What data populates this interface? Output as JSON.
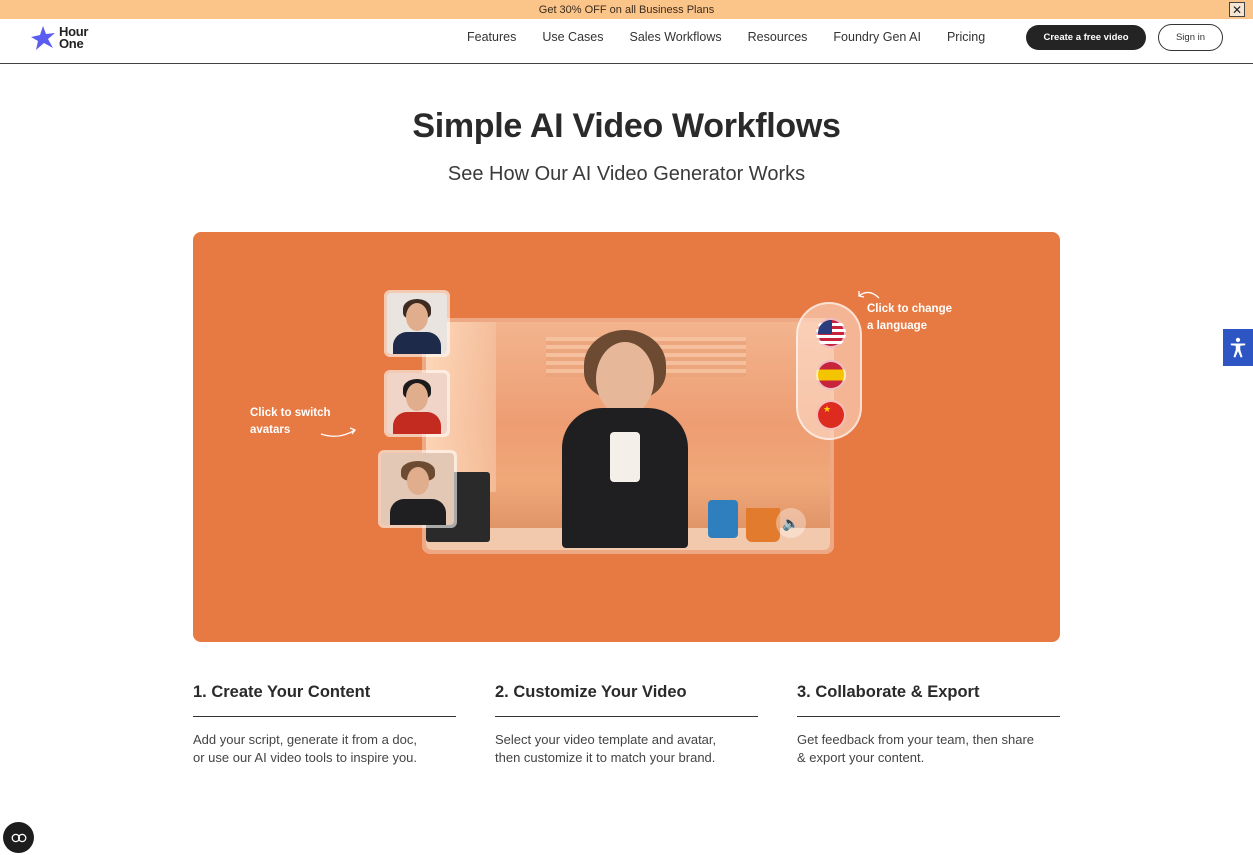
{
  "promo": {
    "text": "Get 30% OFF on all Business Plans",
    "close_icon": "close-icon"
  },
  "brand": {
    "line1": "Hour",
    "line2": "One",
    "accent": "#5b5cf0"
  },
  "nav": {
    "links": [
      "Features",
      "Use Cases",
      "Sales Workflows",
      "Resources",
      "Foundry Gen AI",
      "Pricing"
    ],
    "create_label": "Create a free video",
    "signin_label": "Sign in"
  },
  "hero": {
    "title": "Simple AI Video Workflows",
    "subtitle": "See How Our AI Video Generator Works"
  },
  "demo": {
    "background": "#e77a43",
    "hint_avatars_line1": "Click to switch",
    "hint_avatars_line2": "avatars",
    "hint_language_line1": "Click to change",
    "hint_language_line2": "a language",
    "languages": [
      "us-flag",
      "spain-flag",
      "china-flag"
    ]
  },
  "steps": [
    {
      "title": "1. Create Your Content",
      "desc_line1": "Add your script, generate it from a doc,",
      "desc_line2": "or use our AI video tools to inspire you."
    },
    {
      "title": "2. Customize Your Video",
      "desc_line1": "Select your video template and avatar,",
      "desc_line2": "then customize it to match your brand."
    },
    {
      "title": "3. Collaborate & Export",
      "desc_line1": "Get feedback from your team, then share",
      "desc_line2": "& export your content."
    }
  ],
  "widgets": {
    "accessibility_icon": "accessibility-icon",
    "consent_icon": "consent-icon",
    "accessibility_color": "#2d55c4"
  }
}
